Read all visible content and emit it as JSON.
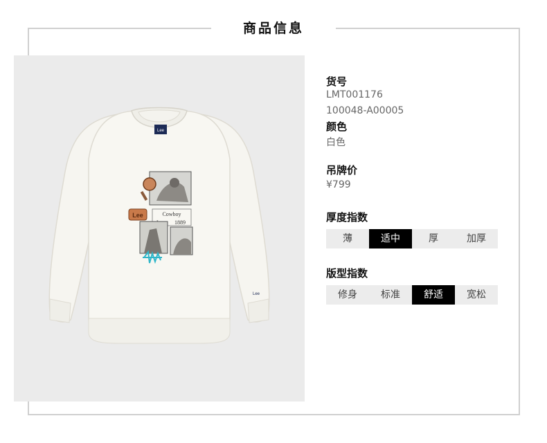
{
  "section_title": "商品信息",
  "product": {
    "sku_label": "货号",
    "sku_value": "LMT001176",
    "code_value": "100048-A00005",
    "color_label": "颜色",
    "color_value": "白色",
    "price_label": "吊牌价",
    "price_value": "¥799"
  },
  "thickness": {
    "label": "厚度指数",
    "options": [
      "薄",
      "适中",
      "厚",
      "加厚"
    ],
    "selected_index": 1
  },
  "fit": {
    "label": "版型指数",
    "options": [
      "修身",
      "标准",
      "舒适",
      "宽松"
    ],
    "selected_index": 2
  },
  "graphic": {
    "brand_text": "Lee",
    "print_text_1": "Cowboy",
    "print_text_2": "Lee",
    "print_text_3": "1889",
    "sleeve_tag": "Lee",
    "accent_color": "#2fb6c9"
  },
  "colors": {
    "border": "#cfcfcf",
    "photo_bg": "#ebebeb",
    "garment": "#f7f6f1",
    "selected_bg": "#000000",
    "unselected_bg": "#ececec"
  }
}
